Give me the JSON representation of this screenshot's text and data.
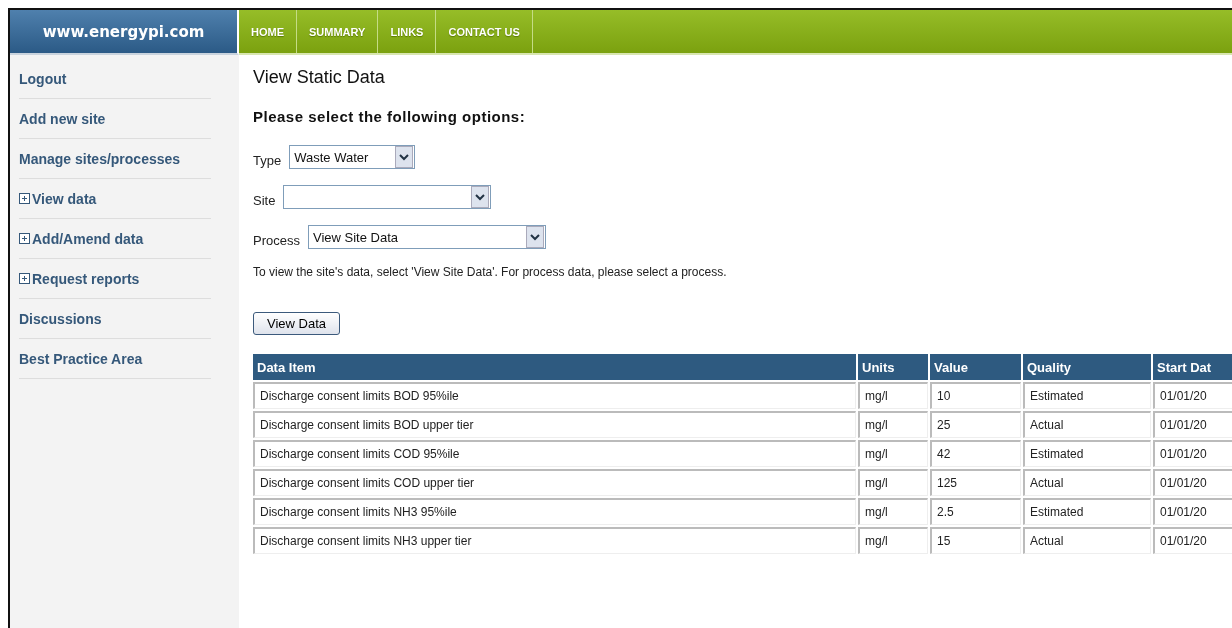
{
  "logo": "www.energypi.com",
  "nav": [
    {
      "label": "HOME"
    },
    {
      "label": "SUMMARY"
    },
    {
      "label": "LINKS"
    },
    {
      "label": "CONTACT US"
    }
  ],
  "sidebar": {
    "items": [
      {
        "label": "Logout",
        "expandable": false
      },
      {
        "label": "Add new site",
        "expandable": false
      },
      {
        "label": "Manage sites/processes",
        "expandable": false
      },
      {
        "label": "View data",
        "expandable": true
      },
      {
        "label": "Add/Amend data",
        "expandable": true
      },
      {
        "label": "Request reports",
        "expandable": true
      },
      {
        "label": "Discussions",
        "expandable": false
      },
      {
        "label": "Best Practice Area",
        "expandable": false
      }
    ]
  },
  "page_title": "View Static Data",
  "subtitle": "Please select the following options:",
  "fields": [
    {
      "label": "Type",
      "value": "Waste Water"
    },
    {
      "label": "Site"
    },
    {
      "label": "Process",
      "value": "View Site Data"
    }
  ],
  "hint": "To view the site's data, select 'View Site Data'. For process data, please select a process.",
  "button": "View Data",
  "table": {
    "columns": [
      "Data Item",
      "Units",
      "Value",
      "Quality",
      "Start Dat"
    ],
    "rows": [
      [
        "Discharge consent limits BOD 95%ile",
        "mg/l",
        "10",
        "Estimated",
        "01/01/20"
      ],
      [
        "Discharge consent limits BOD upper tier",
        "mg/l",
        "25",
        "Actual",
        "01/01/20"
      ],
      [
        "Discharge consent limits COD 95%ile",
        "mg/l",
        "42",
        "Estimated",
        "01/01/20"
      ],
      [
        "Discharge consent limits COD upper tier",
        "mg/l",
        "125",
        "Actual",
        "01/01/20"
      ],
      [
        "Discharge consent limits NH3 95%ile",
        "mg/l",
        "2.5",
        "Estimated",
        "01/01/20"
      ],
      [
        "Discharge consent limits NH3 upper tier",
        "mg/l",
        "15",
        "Actual",
        "01/01/20"
      ]
    ]
  }
}
